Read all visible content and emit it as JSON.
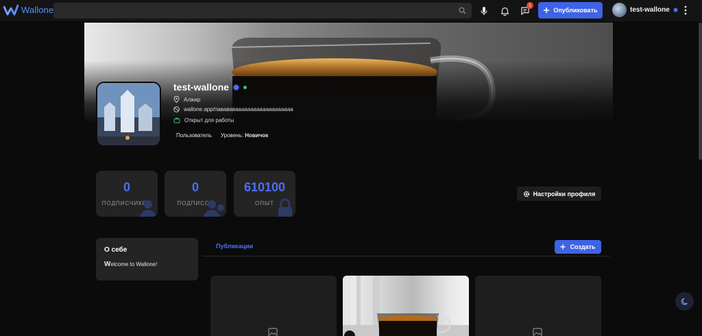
{
  "brand": {
    "name": "Wallone",
    "accent": "#4e6ef0"
  },
  "search": {
    "placeholder": "",
    "value": ""
  },
  "header": {
    "notifications_badge": "1",
    "publish_label": "Опубликовать",
    "username": "test-wallone"
  },
  "profile": {
    "username": "test-wallone",
    "location": "Алжир",
    "website": "wallone.app/павававааааааааааааааааааа",
    "work_status": "Открыт для работы",
    "role": "Пользователь",
    "level_label": "Уровень:",
    "level_value": "Новичок"
  },
  "stats": [
    {
      "value": "0",
      "label": "подписчиков"
    },
    {
      "value": "0",
      "label": "подписок"
    },
    {
      "value": "610100",
      "label": "опыт"
    }
  ],
  "settings_label": "Настройки профиля",
  "about": {
    "title": "О себе",
    "text_first": "W",
    "text_rest": "elcome to Wallone!"
  },
  "tabs": {
    "publications": "Публикации"
  },
  "create_label": "Создать",
  "icons": [
    "search-icon",
    "microphone-icon",
    "bell-icon",
    "messages-icon",
    "plus-icon",
    "kebab-icon",
    "location-icon",
    "globe-icon",
    "briefcase-icon",
    "gear-icon",
    "image-placeholder-icon",
    "moon-icon"
  ]
}
